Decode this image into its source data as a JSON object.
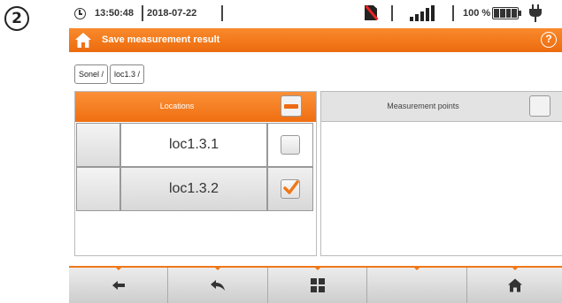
{
  "step_marker": "2",
  "status": {
    "time": "13:50:48",
    "date": "2018-07-22",
    "battery_percent": "100 %",
    "signal_level": 5,
    "icons": [
      "clock-icon",
      "sd-card-removed-icon",
      "signal-strength-icon",
      "battery-icon",
      "plug-icon"
    ]
  },
  "title_bar": {
    "title": "Save measurement result",
    "home_icon": "home-icon",
    "help_label": "?"
  },
  "breadcrumb": [
    "Sonel /",
    "loc1.3 /"
  ],
  "locations_panel": {
    "header": "Locations",
    "header_checkbox_state": "partial",
    "items": [
      {
        "name": "loc1.3.1",
        "checked": false,
        "selected": false
      },
      {
        "name": "loc1.3.2",
        "checked": true,
        "selected": true
      }
    ]
  },
  "points_panel": {
    "header": "Measurement points",
    "header_checkbox_state": "unchecked",
    "items": []
  },
  "bottom_bar": {
    "buttons": [
      {
        "icon": "arrow-left-icon"
      },
      {
        "icon": "return-icon"
      },
      {
        "icon": "grid-icon"
      },
      {
        "icon": "empty"
      },
      {
        "icon": "home-icon"
      }
    ]
  },
  "colors": {
    "accent": "#ee6a12",
    "header_gray": "#e3e3e3",
    "check_orange": "#f07818"
  }
}
